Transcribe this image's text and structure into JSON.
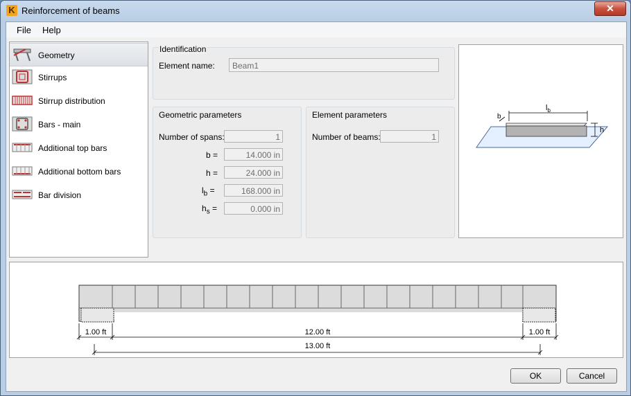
{
  "window": {
    "title": "Reinforcement of beams",
    "close_glyph": "✕",
    "app_icon_letter": "K"
  },
  "menu": [
    {
      "label": "File"
    },
    {
      "label": "Help"
    }
  ],
  "nav": {
    "items": [
      {
        "label": "Geometry",
        "icon": "geometry-icon",
        "selected": true
      },
      {
        "label": "Stirrups",
        "icon": "stirrups-icon"
      },
      {
        "label": "Stirrup distribution",
        "icon": "stirrup-distribution-icon"
      },
      {
        "label": "Bars - main",
        "icon": "bars-main-icon"
      },
      {
        "label": "Additional top bars",
        "icon": "additional-top-bars-icon"
      },
      {
        "label": "Additional bottom bars",
        "icon": "additional-bottom-bars-icon"
      },
      {
        "label": "Bar division",
        "icon": "bar-division-icon"
      }
    ]
  },
  "identification": {
    "title": "Identification",
    "element_name_label": "Element name:",
    "element_name_value": "Beam1"
  },
  "geometric": {
    "title": "Geometric parameters",
    "spans_label": "Number of spans:",
    "spans_value": "1",
    "b_label": "b =",
    "b_value": "14.000 in",
    "h_label": "h =",
    "h_value": "24.000 in",
    "lb_main": "l",
    "lb_sub": "b",
    "lb_eq": "=",
    "lb_value": "168.000 in",
    "hs_main": "h",
    "hs_sub": "s",
    "hs_eq": "=",
    "hs_value": "0.000 in"
  },
  "element": {
    "title": "Element parameters",
    "beams_label": "Number of beams:",
    "beams_value": "1"
  },
  "preview": {
    "lb_main": "l",
    "lb_sub": "b",
    "b": "b",
    "h": "h"
  },
  "diagram": {
    "left_support": "1.00 ft",
    "span": "12.00 ft",
    "right_support": "1.00 ft",
    "total": "13.00 ft"
  },
  "buttons": {
    "ok": "OK",
    "cancel": "Cancel"
  },
  "colors": {
    "accent": "#c33030",
    "beam_fill": "#d9d9d9",
    "plane": "#dfefff"
  }
}
